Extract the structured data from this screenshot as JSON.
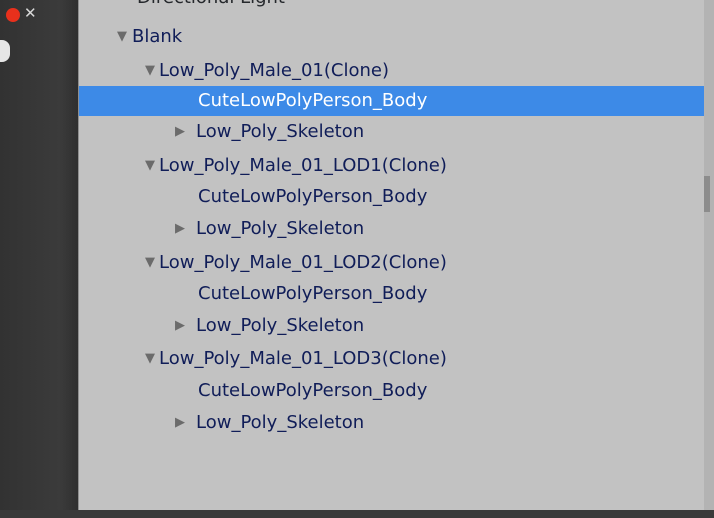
{
  "hierarchy": {
    "partial_top": "Directional Light",
    "expanded_glyph": "▼",
    "collapsed_glyph": "▶",
    "rows": [
      {
        "label": "Blank",
        "arrow": "expanded"
      },
      {
        "label": "Low_Poly_Male_01(Clone)",
        "arrow": "expanded"
      },
      {
        "label": "CuteLowPolyPerson_Body",
        "arrow": "none",
        "selected": true
      },
      {
        "label": "Low_Poly_Skeleton",
        "arrow": "collapsed"
      },
      {
        "label": "Low_Poly_Male_01_LOD1(Clone)",
        "arrow": "expanded"
      },
      {
        "label": "CuteLowPolyPerson_Body",
        "arrow": "none"
      },
      {
        "label": "Low_Poly_Skeleton",
        "arrow": "collapsed"
      },
      {
        "label": "Low_Poly_Male_01_LOD2(Clone)",
        "arrow": "expanded"
      },
      {
        "label": "CuteLowPolyPerson_Body",
        "arrow": "none"
      },
      {
        "label": "Low_Poly_Skeleton",
        "arrow": "collapsed"
      },
      {
        "label": "Low_Poly_Male_01_LOD3(Clone)",
        "arrow": "expanded"
      },
      {
        "label": "CuteLowPolyPerson_Body",
        "arrow": "none"
      },
      {
        "label": "Low_Poly_Skeleton",
        "arrow": "collapsed"
      }
    ]
  },
  "window": {
    "close_glyph": "✕",
    "accent_color": "#e8301c",
    "selection_color": "#3d8ae7"
  }
}
